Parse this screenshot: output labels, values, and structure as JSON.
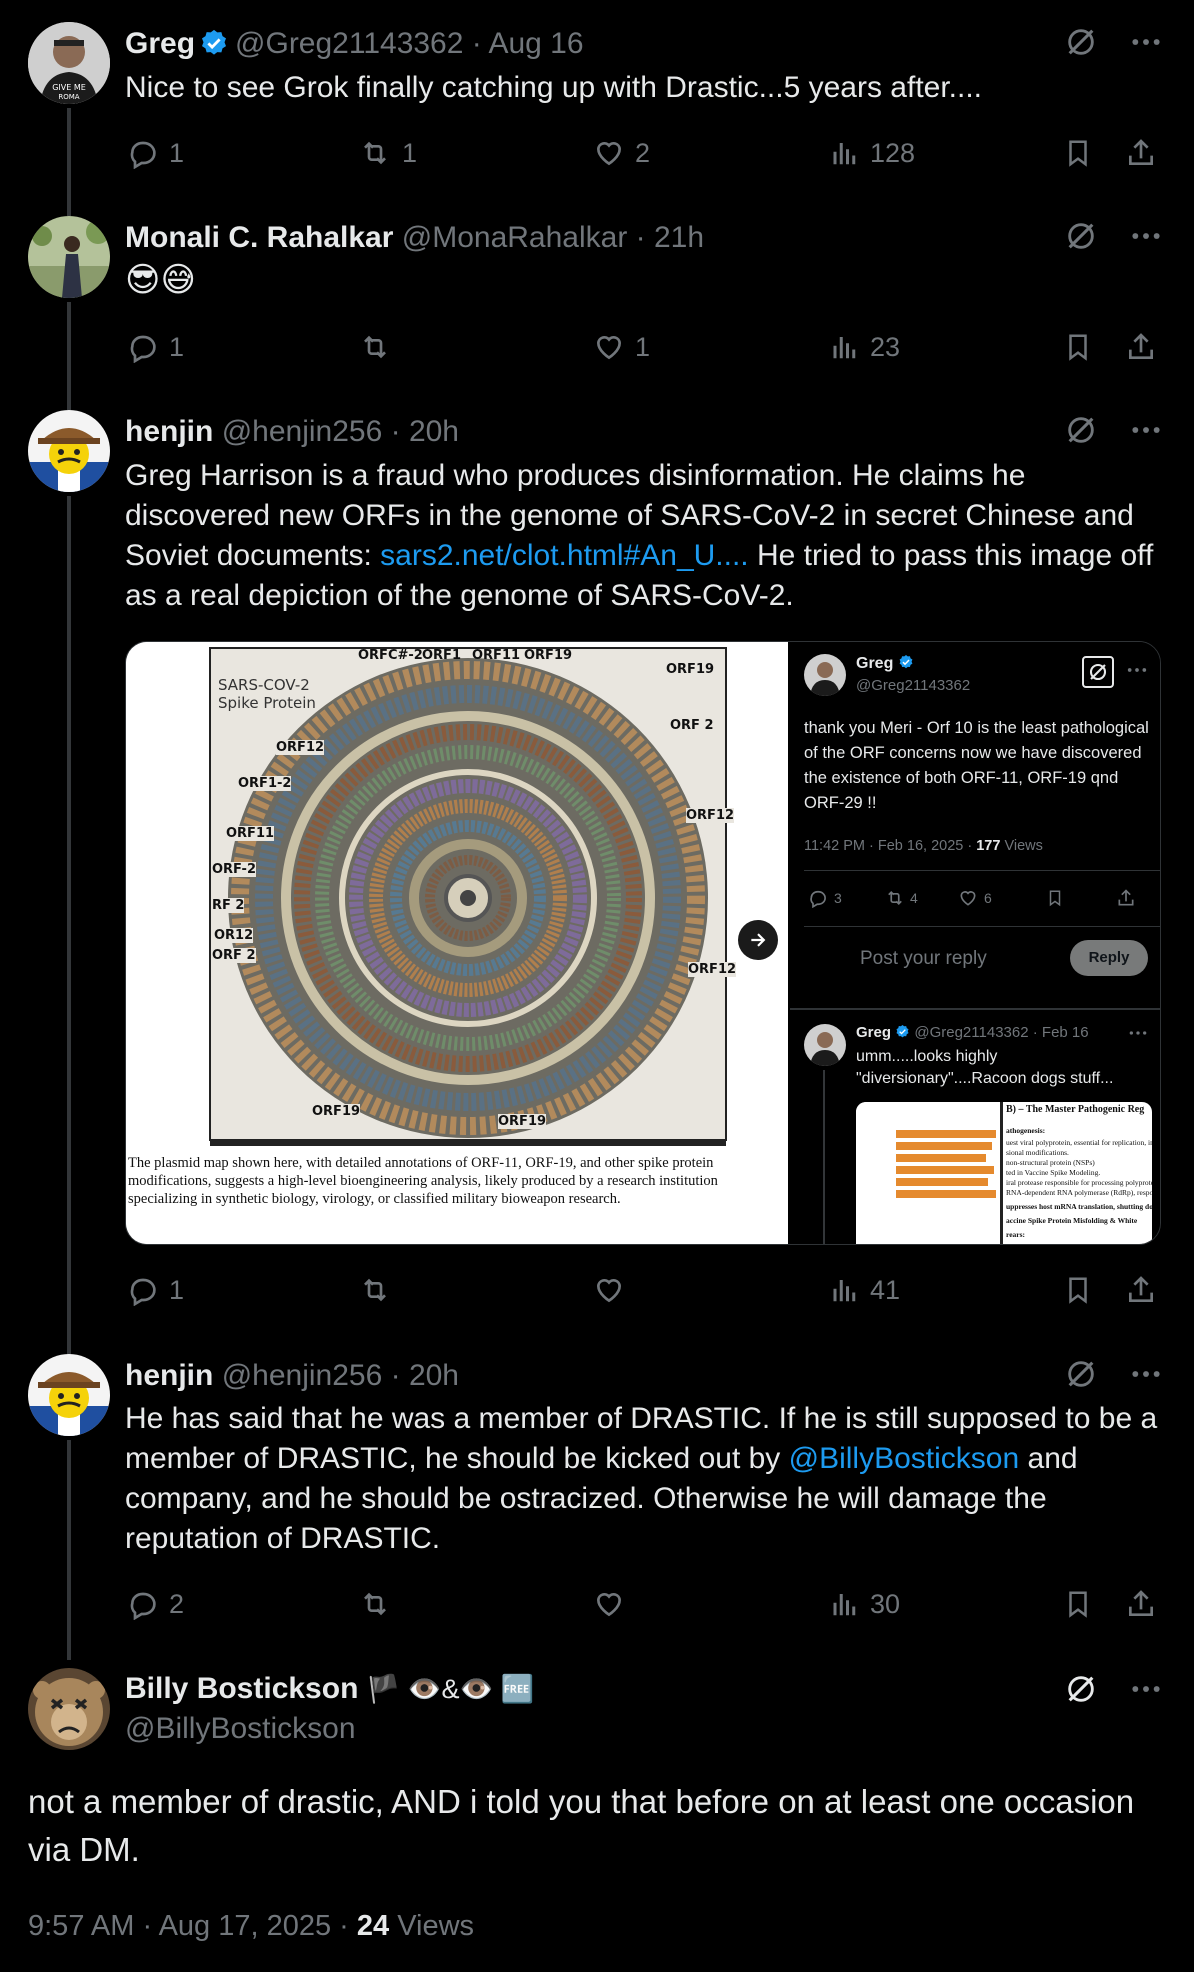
{
  "tweets": [
    {
      "name": "Greg",
      "verified": true,
      "handle": "@Greg21143362",
      "time": "Aug 16",
      "text": "Nice to see Grok finally catching up with Drastic...5  years after....",
      "replies": "1",
      "reposts": "1",
      "likes": "2",
      "views": "128"
    },
    {
      "name": "Monali C. Rahalkar",
      "handle": "@MonaRahalkar",
      "time": "21h",
      "text": "😎😅",
      "replies": "1",
      "reposts": "",
      "likes": "1",
      "views": "23"
    },
    {
      "name": "henjin",
      "handle": "@henjin256",
      "time": "20h",
      "text_part1": "Greg Harrison is a fraud who produces disinformation. He claims he discovered new ORFs in the genome of SARS-CoV-2 in secret Chinese and Soviet documents: ",
      "link": "sars2.net/clot.html#An_U....",
      "text_part2": " He tried to pass this image off as a real depiction of the genome of SARS-CoV-2.",
      "replies": "1",
      "reposts": "",
      "likes": "",
      "views": "41"
    },
    {
      "name": "henjin",
      "handle": "@henjin256",
      "time": "20h",
      "text_part1": "He has said that he was a member of DRASTIC. If he is still supposed to be a member of DRASTIC, he should be kicked out by ",
      "mention": "@BillyBostickson",
      "text_part2": " and company, and he should be ostracized. Otherwise he will damage the reputation of DRASTIC.",
      "replies": "2",
      "reposts": "",
      "likes": "",
      "views": "30"
    }
  ],
  "embed": {
    "image_labels": {
      "top": [
        "ORFC#-2",
        "ORF1",
        "ORF11",
        "ORF19"
      ],
      "title1": "SARS-COV-2",
      "title2": "Spike Protein",
      "left": [
        "ORF12",
        "ORF1-2",
        "ORF11",
        "ORF-2",
        "RF 2",
        "OR12",
        "ORF 2"
      ],
      "right": [
        "ORF19",
        "ORF 2",
        "ORF12",
        "ORF12"
      ],
      "bottom": [
        "ORF19",
        "ORF19"
      ],
      "caption": "The plasmid map shown here, with detailed annotations of ORF-11, ORF-19, and other spike protein modifications, suggests a high-level bioengineering analysis, likely produced by a research institution specializing in synthetic biology, virology, or classified military bioweapon research."
    },
    "quoted": {
      "name": "Greg",
      "handle": "@Greg21143362",
      "text": "thank you Meri - Orf 10 is the least pathological of the ORF concerns now we have discovered the existence of both ORF-11, ORF-19 qnd ORF-29 !!",
      "time": "11:42 PM · Feb 16, 2025 · ",
      "views_count": "177",
      "views_label": " Views",
      "replies": "3",
      "reposts": "4",
      "likes": "6",
      "reply_placeholder": "Post your reply",
      "reply_button": "Reply"
    },
    "nested": {
      "name": "Greg",
      "handle": "@Greg21143362",
      "time": "Feb 16",
      "text": "umm.....looks highly \"diversionary\"....Racoon dogs stuff...",
      "doc_heading": "B) – The Master Pathogenic Reg",
      "doc_lines": [
        "athogenesis:",
        "uest viral polyprotein, essential for replication, im",
        "sional modifications.",
        "non-structural protein (NSPs)",
        "ted in Vaccine Spike Modeling.",
        "iral protease responsible for processing polyprotei",
        "RNA-dependent RNA polymerase (RdRp), respon",
        "uppresses host mRNA translation, shutting down",
        "accine Spike Protein Misfolding & White",
        "rears:"
      ]
    }
  },
  "main": {
    "name": "Billy Bostickson",
    "emojis": "🏴 👁️&👁️ 🆓",
    "handle": "@BillyBostickson",
    "text": "not a member of drastic, AND  i told you that before on at least one occasion via DM.",
    "time": "9:57 AM · Aug 17, 2025 · ",
    "views_count": "24",
    "views_label": " Views"
  },
  "colors": {
    "background": "#000000",
    "text": "#e7e9ea",
    "secondary": "#71767b",
    "link": "#1d9bf0",
    "verified": "#1d9bf0"
  }
}
